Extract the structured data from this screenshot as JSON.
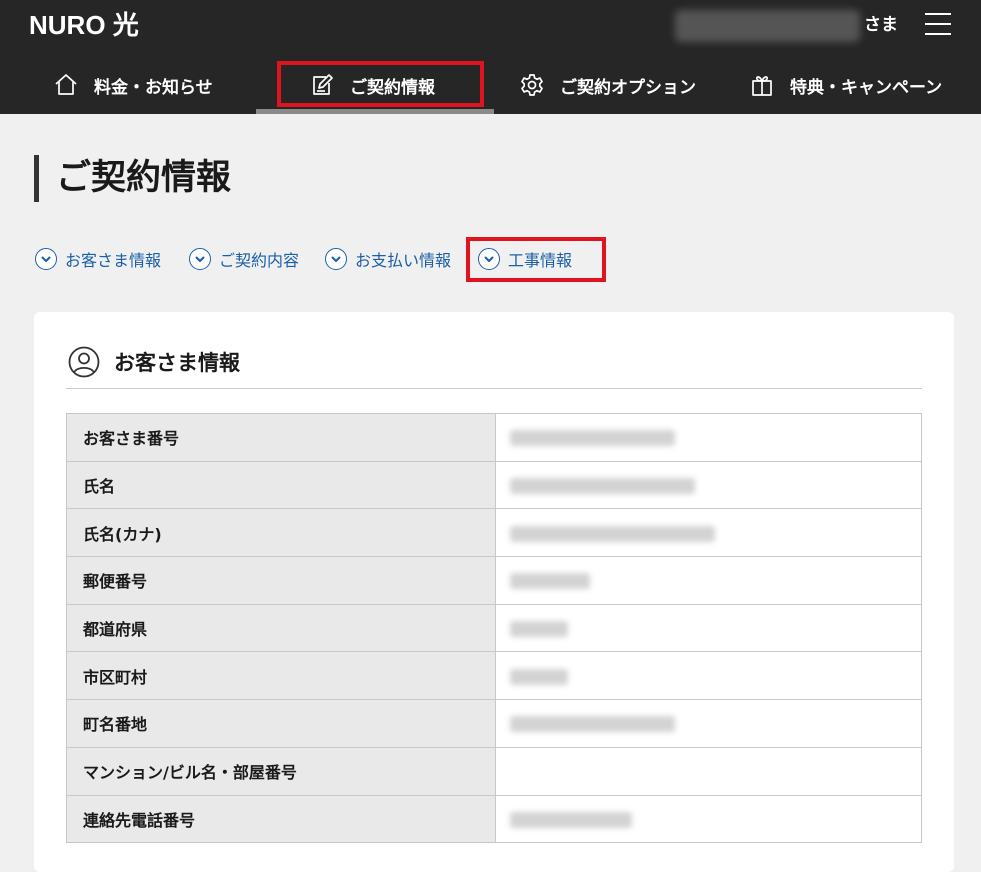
{
  "header": {
    "logo": "NURO 光",
    "user_suffix": "さま",
    "nav": [
      {
        "label": "料金・お知らせ",
        "icon": "home-icon"
      },
      {
        "label": "ご契約情報",
        "icon": "edit-document-icon",
        "active": true
      },
      {
        "label": "ご契約オプション",
        "icon": "gear-icon"
      },
      {
        "label": "特典・キャンペーン",
        "icon": "gift-icon"
      }
    ]
  },
  "page": {
    "title": "ご契約情報"
  },
  "anchors": [
    {
      "label": "お客さま情報"
    },
    {
      "label": "ご契約内容"
    },
    {
      "label": "お支払い情報"
    },
    {
      "label": "工事情報",
      "highlighted": true
    }
  ],
  "section": {
    "title": "お客さま情報",
    "icon": "user-circle-icon",
    "rows": [
      {
        "label": "お客さま番号",
        "masked": true
      },
      {
        "label": "氏名",
        "masked": true
      },
      {
        "label": "氏名(カナ)",
        "masked": true
      },
      {
        "label": "郵便番号",
        "masked": true
      },
      {
        "label": "都道府県",
        "masked": true
      },
      {
        "label": "市区町村",
        "masked": true
      },
      {
        "label": "町名番地",
        "masked": true
      },
      {
        "label": "マンション/ビル名・部屋番号",
        "masked": false
      },
      {
        "label": "連絡先電話番号",
        "masked": true
      }
    ]
  },
  "colors": {
    "header_bg": "#262626",
    "link": "#1a5fa8",
    "highlight": "#e0141e",
    "page_bg": "#f0f0f0",
    "label_bg": "#e9e9e9"
  }
}
